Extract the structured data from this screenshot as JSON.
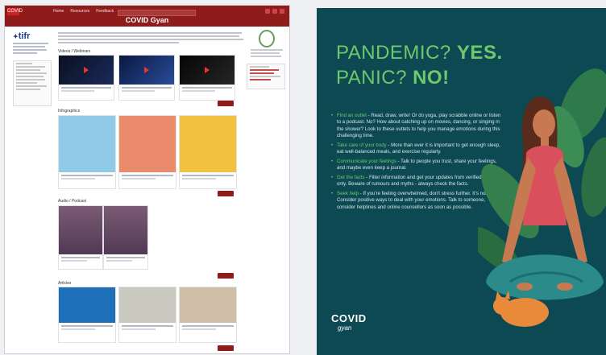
{
  "site": {
    "title": "COVID Gyan",
    "logo": "COVID",
    "nav": [
      "Home",
      "Resources",
      "Feedback"
    ],
    "tifr_logo": "tifr",
    "sections": [
      {
        "label": "Videos / Webinars"
      },
      {
        "label": "Infographics"
      },
      {
        "label": "Audio / Podcast"
      },
      {
        "label": "Articles"
      }
    ],
    "view_more": "View more"
  },
  "poster": {
    "title_line1_a": "PANDEMIC?",
    "title_line1_b": "YES.",
    "title_line2_a": "PANIC?",
    "title_line2_b": "NO!",
    "tips": [
      {
        "head": "Find an outlet",
        "body": " - Read, draw, write! Or do yoga, play scrabble online or listen to a podcast. No? How about catching up on movies, dancing, or singing in the shower? Look to these outlets to help you manage emotions during this challenging time."
      },
      {
        "head": "Take care of your body",
        "body": " - More than ever it is important to get enough sleep, eat well-balanced meals, and exercise regularly."
      },
      {
        "head": "Communicate your feelings",
        "body": " - Talk to people you trust, share your feelings, and maybe even keep a journal."
      },
      {
        "head": "Get the facts",
        "body": " - Filter information and get your updates from verified sources only. Beware of rumours and myths - always check the facts."
      },
      {
        "head": "Seek help",
        "body": " - If you're feeling overwhelmed, don't stress further. It's normal. Consider positive ways to deal with your emotions. Talk to someone, consider helplines and online counsellors as soon as possible."
      }
    ],
    "logo_top": "COVID",
    "logo_bottom": "gyan"
  },
  "colors": {
    "brand_red": "#8f1b1b",
    "poster_bg": "#0c4953",
    "poster_green": "#6fc96a",
    "woman_top": "#d94f5c",
    "cat": "#e88a3a"
  }
}
